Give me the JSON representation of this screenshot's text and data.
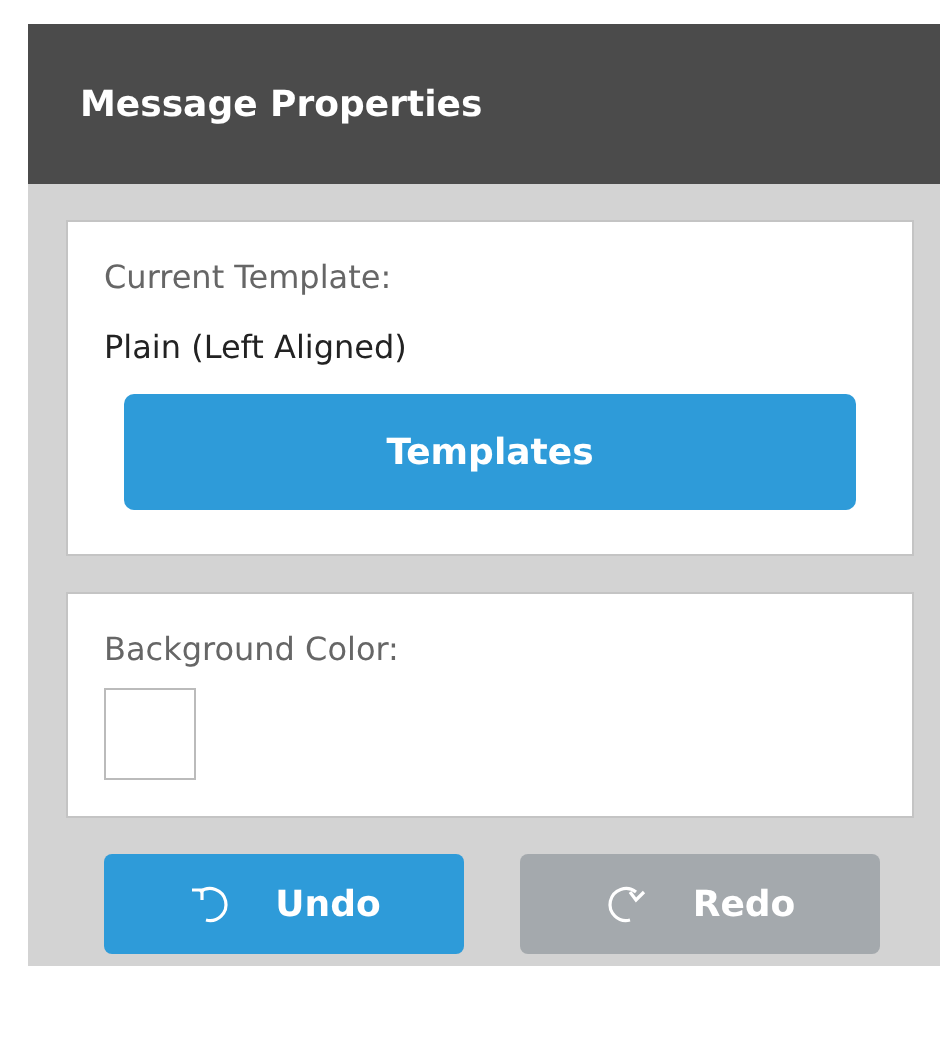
{
  "panel": {
    "title": "Message Properties"
  },
  "template": {
    "label": "Current Template:",
    "value": "Plain (Left Aligned)",
    "button": "Templates"
  },
  "background_color": {
    "label": "Background Color:",
    "color": "#ffffff"
  },
  "actions": [
    {
      "kind": "undo",
      "label": "Undo",
      "disabled": false
    },
    {
      "kind": "redo",
      "label": "Redo",
      "disabled": true
    }
  ]
}
